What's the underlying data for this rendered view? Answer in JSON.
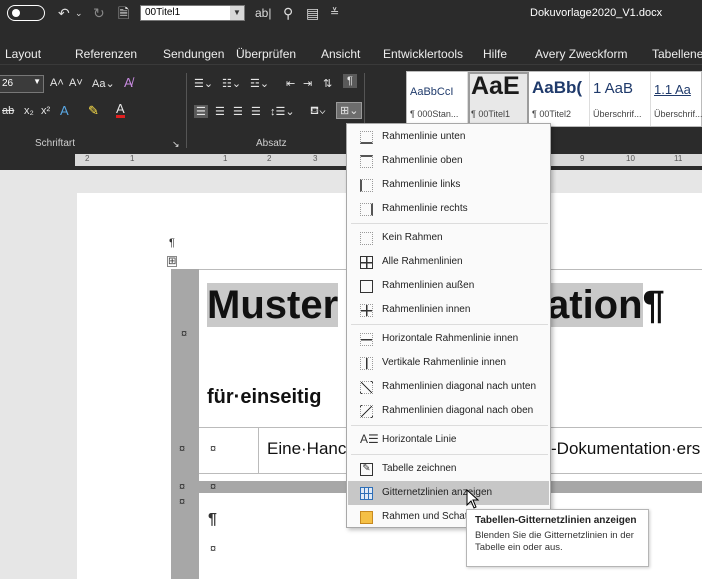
{
  "qat": {
    "style_value": "00Titel1",
    "doc_title": "Dokuvorlage2020_V1.docx"
  },
  "tabs": [
    "Layout",
    "Referenzen",
    "Sendungen",
    "Überprüfen",
    "Ansicht",
    "Entwicklertools",
    "Hilfe",
    "Avery Zweckform",
    "Tabellenen"
  ],
  "ribbon": {
    "font_size": "26",
    "groups": {
      "font": "Schriftart",
      "paragraph": "Absatz"
    },
    "styles": [
      {
        "preview": "AaBbCcI",
        "label": "¶ 000Stan..."
      },
      {
        "preview": "AaE",
        "label": "¶ 00Titel1"
      },
      {
        "preview": "AaBb(",
        "label": "¶ 00Titel2"
      },
      {
        "preview": "1 AaB",
        "label": "Überschrif..."
      },
      {
        "preview": "1.1 Aa",
        "label": "Überschrif..."
      }
    ]
  },
  "ruler": {
    "ticks": [
      "2",
      "1",
      "1",
      "2",
      "3",
      "9",
      "10",
      "11"
    ]
  },
  "document": {
    "title_left": "Muster",
    "title_right": "ation",
    "subtitle": "für·einseitig",
    "row_text_left": "Eine·Hanc",
    "row_text_right": "-Dokumentation·ers",
    "pilcrow": "¶",
    "cell_mark": "¤",
    "move_handle": "⊞"
  },
  "menu": {
    "items": [
      {
        "label": "Rahmenlinie unten",
        "icon": "border-bottom-icon"
      },
      {
        "label": "Rahmenlinie oben",
        "icon": "border-top-icon"
      },
      {
        "label": "Rahmenlinie links",
        "icon": "border-left-icon"
      },
      {
        "label": "Rahmenlinie rechts",
        "icon": "border-right-icon"
      },
      {
        "label": "Kein Rahmen",
        "icon": "no-border-icon"
      },
      {
        "label": "Alle Rahmenlinien",
        "icon": "all-borders-icon"
      },
      {
        "label": "Rahmenlinien außen",
        "icon": "outside-borders-icon"
      },
      {
        "label": "Rahmenlinien innen",
        "icon": "inside-borders-icon"
      },
      {
        "label": "Horizontale Rahmenlinie innen",
        "icon": "inside-horizontal-border-icon"
      },
      {
        "label": "Vertikale Rahmenlinie innen",
        "icon": "inside-vertical-border-icon"
      },
      {
        "label": "Rahmenlinien diagonal nach unten",
        "icon": "diagonal-down-border-icon"
      },
      {
        "label": "Rahmenlinien diagonal nach oben",
        "icon": "diagonal-up-border-icon"
      },
      {
        "label": "Horizontale Linie",
        "icon": "horizontal-line-icon"
      },
      {
        "label": "Tabelle zeichnen",
        "icon": "draw-table-icon"
      },
      {
        "label": "Gitternetzlinien anzeigen",
        "icon": "view-gridlines-icon"
      },
      {
        "label": "Rahmen und Schattierung...",
        "icon": "borders-shading-icon"
      }
    ]
  },
  "tooltip": {
    "title": "Tabellen-Gitternetzlinien anzeigen",
    "description": "Blenden Sie die Gitternetzlinien in der Tabelle ein oder aus."
  }
}
